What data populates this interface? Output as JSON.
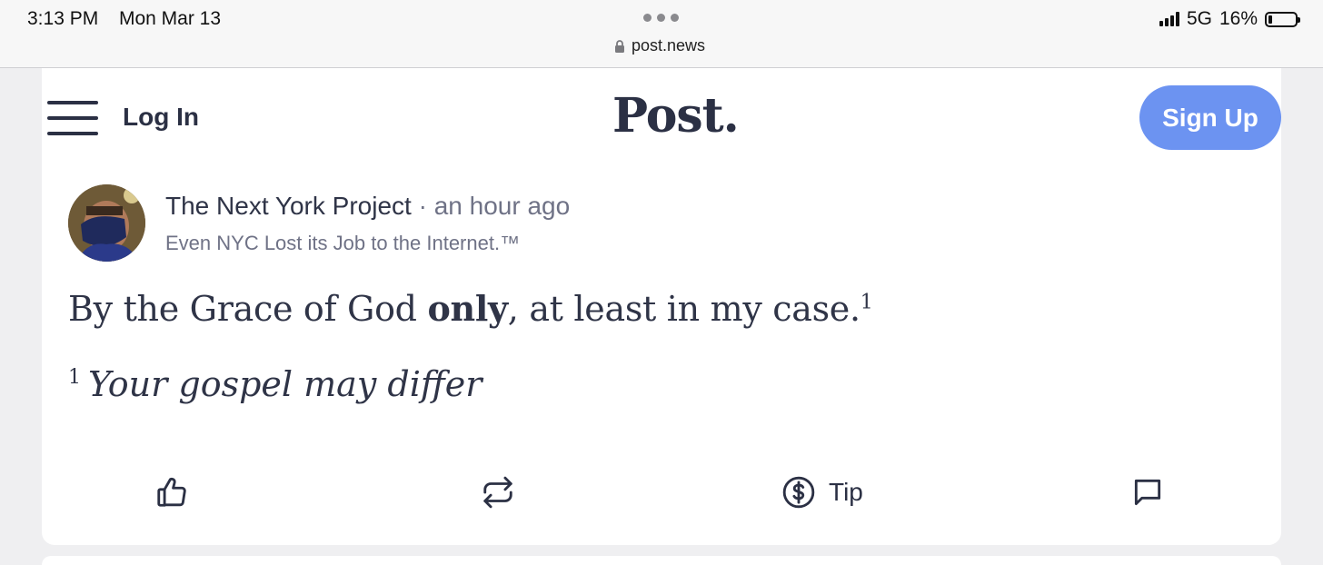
{
  "status_bar": {
    "time": "3:13 PM",
    "date": "Mon Mar 13",
    "url": "post.news",
    "network": "5G",
    "battery": "16%",
    "battery_level": 0.16
  },
  "header": {
    "login_label": "Log In",
    "logo": "Post.",
    "signup_label": "Sign Up"
  },
  "post": {
    "author": "The Next York Project",
    "separator": "·",
    "time": "an hour ago",
    "tagline": "Even NYC Lost its Job to the Internet.™",
    "text_before": "By the Grace of God ",
    "text_bold": "only",
    "text_after": ", at least in my case.",
    "footnote_marker": "1",
    "footnote_text": "Your gospel may differ"
  },
  "actions": {
    "tip_label": "Tip"
  },
  "colors": {
    "accent": "#6c93f1",
    "text": "#2b3044",
    "muted": "#6f7286"
  }
}
